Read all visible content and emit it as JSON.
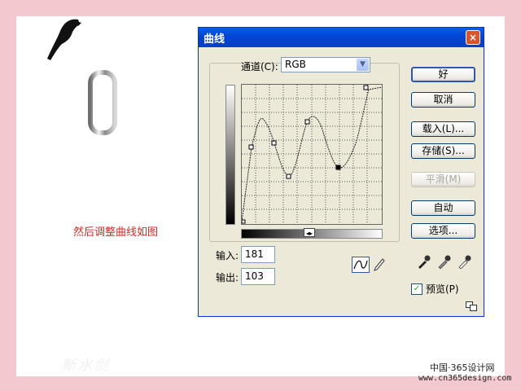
{
  "page": {
    "caption": "然后调整曲线如图",
    "watermark": "断水剑",
    "site_cn": "中国·365设计网",
    "site_url": "www.cn365design.com"
  },
  "dialog": {
    "title": "曲线",
    "close_label": "×",
    "channel_label": "通道(C):",
    "channel_value": "RGB",
    "input_label": "输入:",
    "input_value": "181",
    "output_label": "输出:",
    "output_value": "103",
    "buttons": {
      "ok": "好",
      "cancel": "取消",
      "load": "载入(L)...",
      "save": "存储(S)...",
      "smooth": "平滑(M)",
      "auto": "自动",
      "options": "选项..."
    },
    "preview_label": "预览(P)",
    "preview_checked": true
  },
  "icons": [
    "parrot-icon",
    "ring-image",
    "curve-tool-icon",
    "pencil-icon",
    "eyedropper-black-icon",
    "eyedropper-gray-icon",
    "eyedropper-white-icon",
    "resize-icon"
  ],
  "colors": {
    "caption": "#d22a2a",
    "titlebar": "#0046d5",
    "background": "#f3c9cf"
  }
}
